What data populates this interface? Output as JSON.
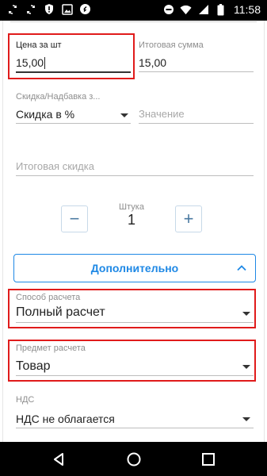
{
  "status_bar": {
    "time": "11:58",
    "left_icons": [
      "sync-icon",
      "sync-icon",
      "shield-alert-icon",
      "image-icon",
      "shazam-icon"
    ],
    "right_icons": [
      "do-not-disturb-icon",
      "wifi-icon",
      "signal-icon",
      "battery-icon"
    ]
  },
  "form": {
    "price_per_unit": {
      "label": "Цена за шт",
      "value": "15,00"
    },
    "total_sum": {
      "label": "Итоговая сумма",
      "value": "15,00"
    },
    "discount_type": {
      "label": "Скидка/Надбавка з...",
      "value": "Скидка в %"
    },
    "discount_value": {
      "placeholder": "Значение"
    },
    "total_discount": {
      "placeholder": "Итоговая скидка"
    },
    "quantity": {
      "unit": "Штука",
      "value": "1",
      "minus": "−",
      "plus": "+"
    },
    "more_button": {
      "label": "Дополнительно"
    },
    "payment_method": {
      "label": "Способ расчета",
      "value": "Полный расчет"
    },
    "payment_subject": {
      "label": "Предмет расчета",
      "value": "Товар"
    },
    "vat": {
      "label": "НДС",
      "value": "НДС не облагается"
    }
  },
  "highlight_color": "#e01b1b",
  "accent_color": "#1e88e5"
}
